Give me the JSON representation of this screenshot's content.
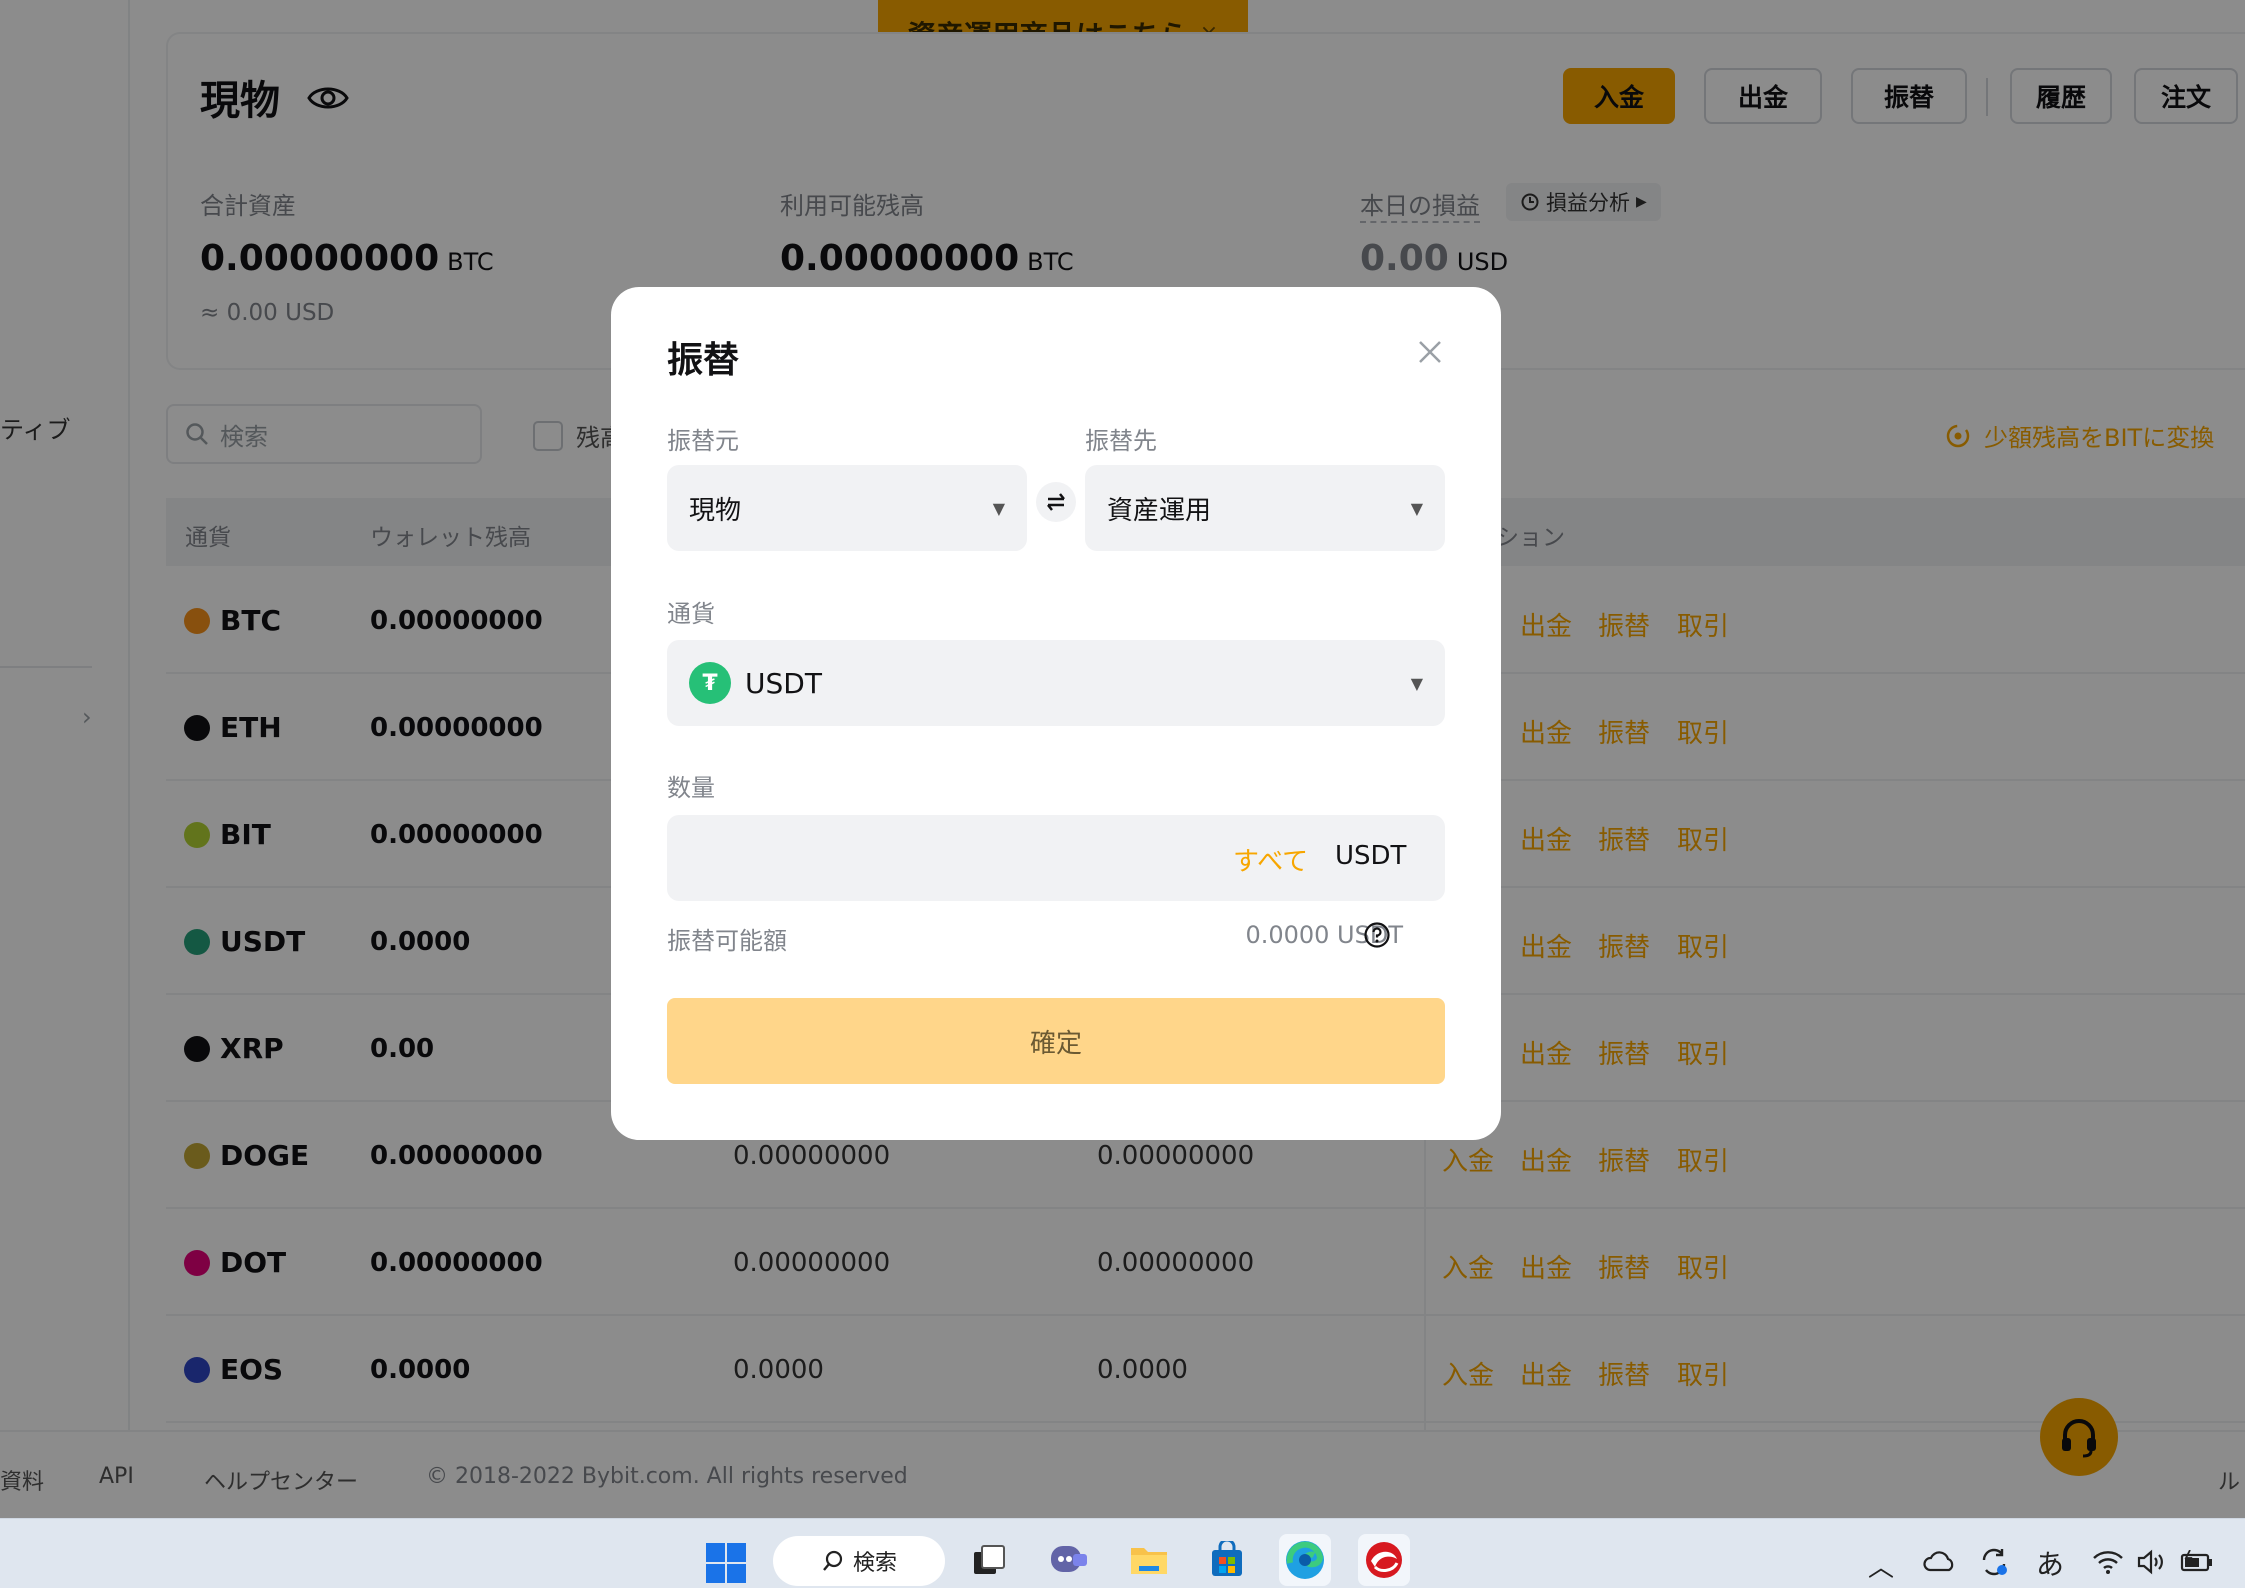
{
  "promo": {
    "text": "資産運用商品はこちら",
    "close": "×"
  },
  "left_rail": {
    "label": "ティブ"
  },
  "header": {
    "title": "現物",
    "buttons": {
      "deposit": "入金",
      "withdraw": "出金",
      "transfer": "振替",
      "history": "履歴",
      "orders": "注文"
    }
  },
  "stats": {
    "total_label": "合計資産",
    "total_value": "0.00000000",
    "total_unit": "BTC",
    "total_usd": "≈ 0.00 USD",
    "available_label": "利用可能残高",
    "available_value": "0.00000000",
    "available_unit": "BTC",
    "pnl_label": "本日の損益",
    "pnl_value": "0.00",
    "pnl_unit": "USD",
    "pnl_analysis": "損益分析"
  },
  "toolbar": {
    "search_placeholder": "検索",
    "hide_small": "残高",
    "convert": "少額残高をBITに変換"
  },
  "table": {
    "headers": {
      "coin": "通貨",
      "wallet": "ウォレット残高",
      "actions": "ション"
    },
    "rows": [
      {
        "coin": "BTC",
        "wallet": "0.00000000",
        "available": "",
        "frozen": "",
        "color": "#f7931a"
      },
      {
        "coin": "ETH",
        "wallet": "0.00000000",
        "available": "",
        "frozen": "",
        "color": "#121214"
      },
      {
        "coin": "BIT",
        "wallet": "0.00000000",
        "available": "",
        "frozen": "",
        "color": "#b3d334"
      },
      {
        "coin": "USDT",
        "wallet": "0.0000",
        "available": "",
        "frozen": "",
        "color": "#26a17b"
      },
      {
        "coin": "XRP",
        "wallet": "0.00",
        "available": "",
        "frozen": "",
        "color": "#121214"
      },
      {
        "coin": "DOGE",
        "wallet": "0.00000000",
        "available": "0.00000000",
        "frozen": "0.00000000",
        "color": "#c2a633"
      },
      {
        "coin": "DOT",
        "wallet": "0.00000000",
        "available": "0.00000000",
        "frozen": "0.00000000",
        "color": "#e6007a"
      },
      {
        "coin": "EOS",
        "wallet": "0.0000",
        "available": "0.0000",
        "frozen": "0.0000",
        "color": "#2f45c5"
      }
    ],
    "actions": {
      "deposit": "入金",
      "withdraw": "出金",
      "transfer": "振替",
      "trade": "取引"
    }
  },
  "footer": {
    "docs": "資料",
    "api": "API",
    "help": "ヘルプセンター",
    "copyright": "© 2018-2022 Bybit.com. All rights reserved",
    "right": "ル"
  },
  "modal": {
    "title": "振替",
    "from_label": "振替元",
    "from_value": "現物",
    "to_label": "振替先",
    "to_value": "資産運用",
    "currency_label": "通貨",
    "currency_value": "USDT",
    "amount_label": "数量",
    "amount_value": "",
    "amount_max": "すべて",
    "amount_unit": "USDT",
    "available_label": "振替可能額",
    "available_value": "0.0000 USDT",
    "confirm": "確定"
  },
  "taskbar": {
    "search": "検索",
    "ime": "あ"
  },
  "colors": {
    "accent": "#f7a600",
    "confirm_disabled": "#ffd68a",
    "usdt": "#26c077"
  }
}
